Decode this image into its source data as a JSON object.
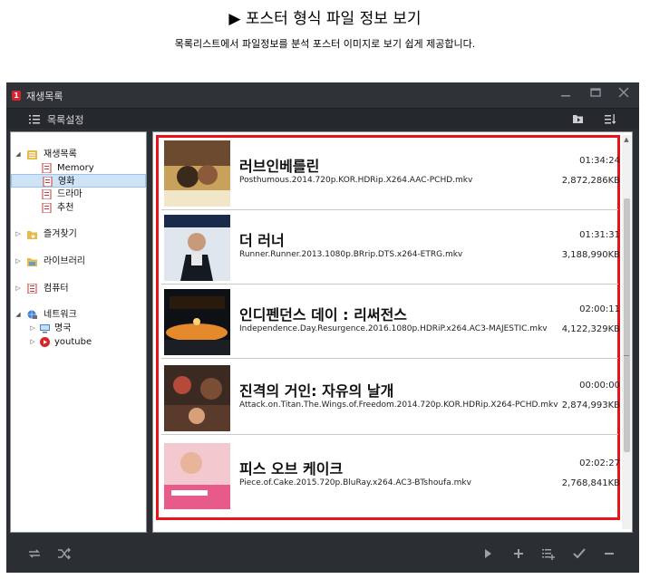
{
  "header": {
    "title": "▶ 포스터 형식 파일 정보 보기",
    "subtitle": "목록리스트에서 파일정보를 분석  포스터 이미지로 보기 쉽게 제공합니다."
  },
  "window": {
    "title": "재생목록",
    "logo_text": "1",
    "toolbar_label": "목록설정",
    "controls": [
      "minimize",
      "maximize",
      "close"
    ]
  },
  "sidebar": {
    "root": {
      "label": "재생목록",
      "icon": "playlist-icon"
    },
    "children": [
      {
        "label": "Memory",
        "icon": "playlist-file-icon"
      },
      {
        "label": "영화",
        "icon": "playlist-file-icon",
        "selected": true
      },
      {
        "label": "드라마",
        "icon": "playlist-file-icon"
      },
      {
        "label": "추천",
        "icon": "playlist-file-icon"
      }
    ],
    "sections": [
      {
        "label": "즐겨찾기",
        "icon": "folder-star-icon"
      },
      {
        "label": "라이브러리",
        "icon": "library-icon"
      },
      {
        "label": "컴퓨터",
        "icon": "computer-icon"
      },
      {
        "label": "네트워크",
        "icon": "network-icon"
      }
    ],
    "network_children": [
      {
        "label": "명국",
        "icon": "network-pc-icon"
      },
      {
        "label": "youtube",
        "icon": "youtube-icon"
      }
    ]
  },
  "playlist": {
    "items": [
      {
        "title": "러브인베를린",
        "filename": "Posthumous.2014.720p.KOR.HDRip.X264.AAC-PCHD.mkv",
        "duration": "01:34:24",
        "size": "2,872,286KB",
        "poster_colors": [
          "#6b4a2f",
          "#c8a25a"
        ]
      },
      {
        "title": "더 러너",
        "filename": "Runner.Runner.2013.1080p.BRrip.DTS.x264-ETRG.mkv",
        "duration": "01:31:31",
        "size": "3,188,990KB",
        "poster_colors": [
          "#1a2a4a",
          "#e0e6ee"
        ]
      },
      {
        "title": "인디펜던스 데이 : 리써전스",
        "filename": "Independence.Day.Resurgence.2016.1080p.HDRiP.x264.AC3-MAJESTIC.mkv",
        "duration": "02:00:11",
        "size": "4,122,329KB",
        "poster_colors": [
          "#0d1014",
          "#e58a2c"
        ]
      },
      {
        "title": "진격의 거인: 자유의 날개",
        "filename": "Attack.on.Titan.The.Wings.of.Freedom.2014.720p.KOR.HDRip.X264-PCHD.mkv",
        "duration": "00:00:00",
        "size": "2,874,993KB",
        "poster_colors": [
          "#3a2a22",
          "#b54a3a"
        ]
      },
      {
        "title": "피스 오브 케이크",
        "filename": "Piece.of.Cake.2015.720p.BluRay.x264.AC3-BTshoufa.mkv",
        "duration": "02:02:27",
        "size": "2,768,841KB",
        "poster_colors": [
          "#f3c9cf",
          "#e75a8a"
        ]
      }
    ]
  },
  "bottom_controls": [
    "repeat-icon",
    "shuffle-icon",
    "play-icon",
    "add-icon",
    "add-to-list-icon",
    "check-icon",
    "remove-icon"
  ]
}
